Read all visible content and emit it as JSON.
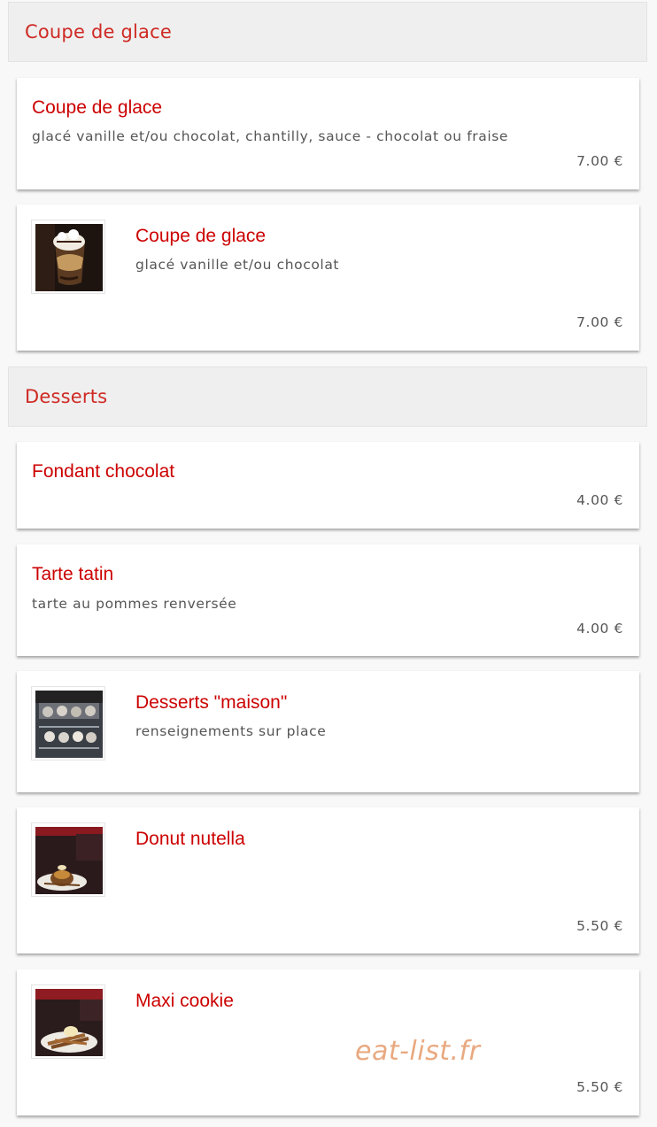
{
  "sections": [
    {
      "title": "Coupe de glace",
      "items": [
        {
          "name": "Coupe de glace",
          "desc": "glacé vanille et/ou chocolat, chantilly, sauce - chocolat ou fraise",
          "price": "7.00 €"
        },
        {
          "name": "Coupe de glace",
          "desc": "glacé vanille et/ou chocolat",
          "price": "7.00 €",
          "photo": "ice-cream-sundae-photo"
        }
      ]
    },
    {
      "title": "Desserts",
      "items": [
        {
          "name": "Fondant chocolat",
          "desc": "",
          "price": "4.00 €"
        },
        {
          "name": "Tarte tatin",
          "desc": "tarte au pommes renversée",
          "price": "4.00 €"
        },
        {
          "name": "Desserts \"maison\"",
          "desc": "renseignements sur place",
          "price": "",
          "photo": "dessert-display-photo"
        },
        {
          "name": "Donut nutella",
          "desc": "",
          "price": "5.50 €",
          "photo": "donut-plate-photo"
        },
        {
          "name": "Maxi cookie",
          "desc": "",
          "price": "5.50 €",
          "photo": "cookie-plate-photo"
        }
      ]
    }
  ],
  "watermark": "eat-list.fr",
  "colors": {
    "accent": "#cc0000",
    "section_title": "#cf2a24",
    "section_bg": "#efefef",
    "card_bg": "#ffffff",
    "text": "#555555",
    "watermark": "#e9a980"
  }
}
